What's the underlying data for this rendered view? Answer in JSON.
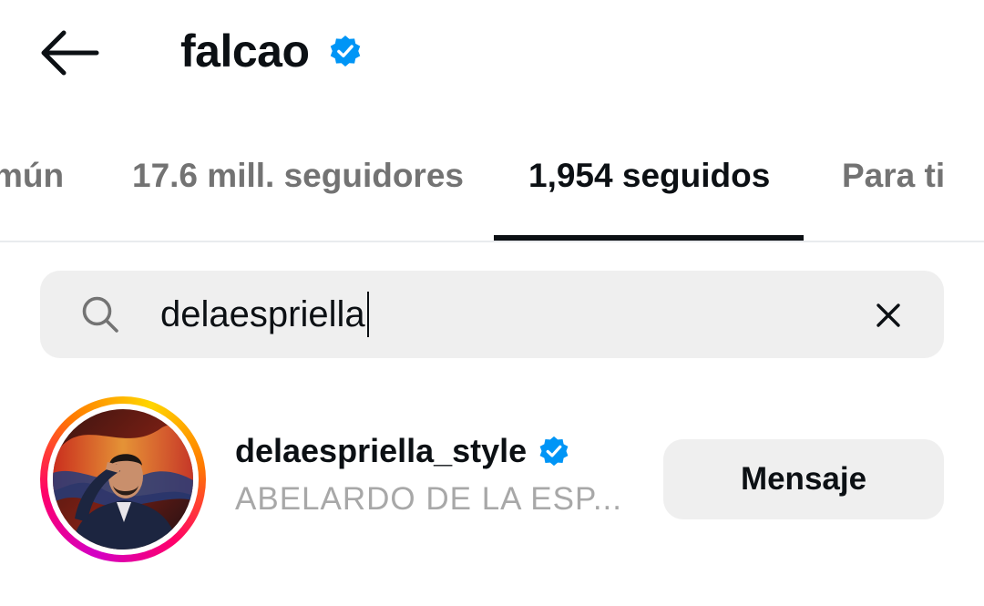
{
  "header": {
    "title": "falcao",
    "back_icon": "arrow-left-icon",
    "verified_icon": "verified-badge-icon"
  },
  "tabs": [
    {
      "label": "mún",
      "active": false
    },
    {
      "label": "17.6 mill. seguidores",
      "active": false
    },
    {
      "label": "1,954 seguidos",
      "active": true
    },
    {
      "label": "Para ti",
      "active": false
    }
  ],
  "search": {
    "value": "delaespriella",
    "search_icon": "search-icon",
    "clear_icon": "close-icon"
  },
  "results": [
    {
      "username": "delaespriella_style",
      "full_name": "ABELARDO DE LA ESP...",
      "verified": true,
      "button_label": "Mensaje"
    }
  ],
  "colors": {
    "text_primary": "#0c1014",
    "text_secondary": "#737373",
    "text_muted": "#a8a8a8",
    "surface": "#efefef",
    "verified_blue": "#0095f6"
  }
}
